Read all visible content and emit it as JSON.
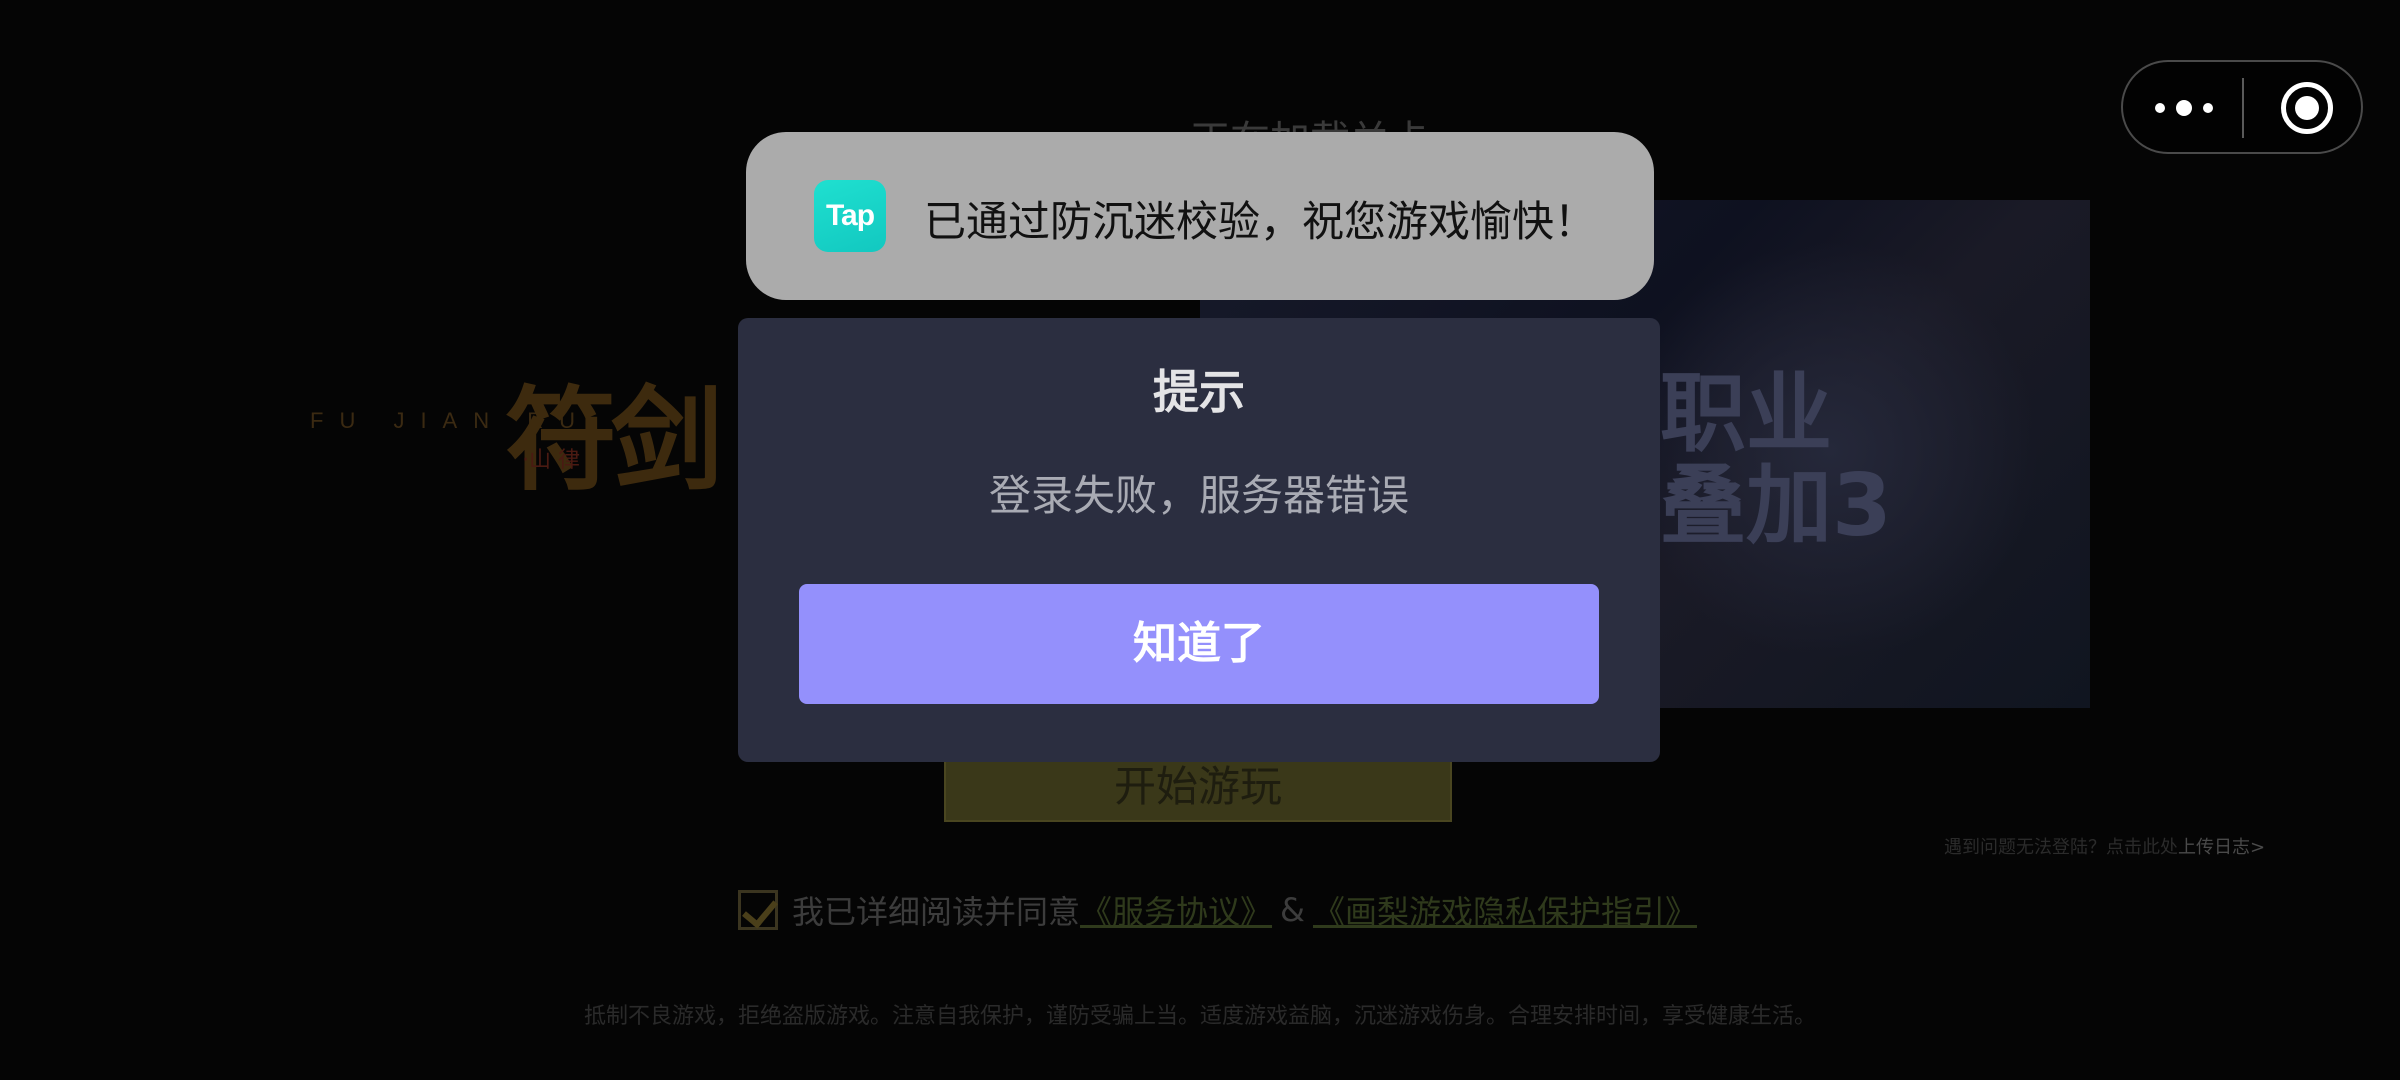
{
  "background": {
    "loading_title": "正在加载关卡",
    "logo": {
      "latin": "FU JIAN RU",
      "cn": "符剑",
      "sub": "·山 律"
    },
    "banner_text": [
      "职业",
      "叠加3"
    ],
    "start_button": "开始游玩",
    "help_prefix": "遇到问题无法登陆？点击此处",
    "help_link": "上传日志>",
    "agree_text": "我已详细阅读并同意",
    "service_link": "《服务协议》",
    "amp": "&",
    "privacy_link": "《画梨游戏隐私保护指引》",
    "footer_note": "抵制不良游戏，拒绝盗版游戏。注意自我保护，谨防受骗上当。适度游戏益脑，沉迷游戏伤身。合理安排时间，享受健康生活。"
  },
  "capsule": {
    "more_icon": "more-dots-icon",
    "close_icon": "close-target-icon"
  },
  "toast": {
    "app_icon_text": "Tap",
    "message": "已通过防沉迷校验，祝您游戏愉快！"
  },
  "dialog": {
    "title": "提示",
    "message": "登录失败，服务器错误",
    "confirm_label": "知道了"
  },
  "colors": {
    "dialog_bg": "#2b2e40",
    "confirm_bg": "#9490fc",
    "toast_bg": "#ababab",
    "tap_brand": "#1fe0d0"
  }
}
